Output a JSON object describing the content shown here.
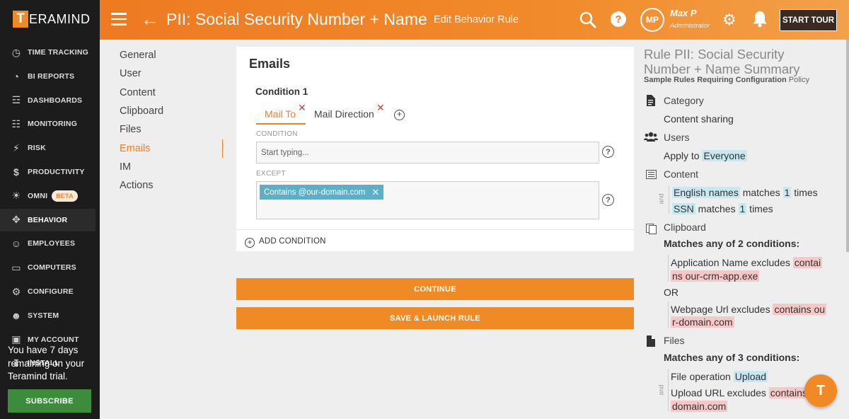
{
  "app": {
    "logo_letter": "T",
    "logo_rest": "ERAMIND"
  },
  "sidebar": {
    "items": [
      {
        "label": "TIME TRACKING",
        "icon": "clock-icon"
      },
      {
        "label": "BI REPORTS",
        "icon": "pie-chart-icon"
      },
      {
        "label": "DASHBOARDS",
        "icon": "chart-icon"
      },
      {
        "label": "MONITORING",
        "icon": "document-icon"
      },
      {
        "label": "RISK",
        "icon": "bolt-icon"
      },
      {
        "label": "PRODUCTIVITY",
        "icon": "dollar-icon"
      },
      {
        "label": "OMNI",
        "icon": "bulb-icon",
        "badge": "BETA"
      },
      {
        "label": "BEHAVIOR",
        "icon": "gamepad-icon",
        "active": true
      },
      {
        "label": "EMPLOYEES",
        "icon": "users-icon"
      },
      {
        "label": "COMPUTERS",
        "icon": "monitor-icon"
      },
      {
        "label": "CONFIGURE",
        "icon": "gear-icon"
      },
      {
        "label": "SYSTEM",
        "icon": "user-gear-icon"
      },
      {
        "label": "MY ACCOUNT",
        "icon": "account-icon"
      },
      {
        "label": "INSTALL",
        "icon": "download-icon"
      }
    ],
    "trial_message": "You have 7 days remaining on your Teramind trial.",
    "subscribe_label": "SUBSCRIBE"
  },
  "header": {
    "title": "PII: Social Security Number + Name",
    "subtitle": "Edit Behavior Rule",
    "avatar_initials": "MP",
    "user_name": "Max P",
    "user_role": "Administrator",
    "start_tour": "START TOUR",
    "help_glyph": "?"
  },
  "subnav": {
    "items": [
      "General",
      "User",
      "Content",
      "Clipboard",
      "Files",
      "Emails",
      "IM",
      "Actions"
    ],
    "active": "Emails"
  },
  "card": {
    "title": "Emails",
    "condition_title": "Condition 1",
    "tabs": [
      "Mail To",
      "Mail Direction"
    ],
    "condition_label": "CONDITION",
    "condition_placeholder": "Start typing...",
    "except_label": "EXCEPT",
    "except_tag": "Contains @our-domain.com",
    "add_condition": "ADD CONDITION"
  },
  "buttons": {
    "continue": "CONTINUE",
    "save_launch": "SAVE & LAUNCH RULE"
  },
  "summary": {
    "title": "Rule PII: Social Security Number + Name Summary",
    "policy_bold": "Sample Rules Requiring Configuration",
    "policy_rest": " Policy",
    "category_head": "Category",
    "category_value": "Content sharing",
    "users_head": "Users",
    "apply_to": "Apply to ",
    "apply_value": "Everyone",
    "content_head": "Content",
    "content_rows": [
      {
        "term": "English names",
        "mid": " matches ",
        "count": "1",
        "end": " times"
      },
      {
        "term": "SSN",
        "mid": " matches ",
        "count": "1",
        "end": " times"
      }
    ],
    "and_label": "and",
    "clipboard_head": "Clipboard",
    "clipboard_match": "Matches any of 2 conditions:",
    "clip1_a": "Application Name excludes ",
    "clip1_hl1": "contai",
    "clip1_hl2": "ns our-crm-app.exe",
    "or_label": "OR",
    "clip2_a": "Webpage Url excludes ",
    "clip2_hl1": "contains ou",
    "clip2_hl2": "r-domain.com",
    "files_head": "Files",
    "files_match": "Matches any of 3 conditions:",
    "file_op_a": "File operation ",
    "file_op_hl": "Upload",
    "upload_a": "Upload URL excludes ",
    "upload_hl1": "contains",
    "upload_hl2": "domain.com"
  },
  "chat_button": "T"
}
